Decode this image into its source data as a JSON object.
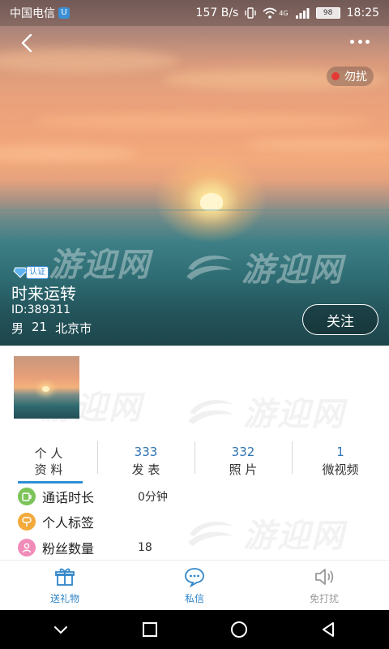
{
  "status_bar": {
    "carrier": "中国电信",
    "carrier_badge": "U",
    "network_speed": "157 B/s",
    "network_type": "4G",
    "battery": "98",
    "time": "18:25"
  },
  "header": {
    "dnd_label": "勿扰",
    "watermark": "游迎网"
  },
  "profile": {
    "verify_badge": "认证",
    "nickname": "时来运转",
    "user_id": "ID:389311",
    "gender": "男",
    "age": "21",
    "city": "北京市",
    "follow_label": "关注"
  },
  "tabs": [
    {
      "count": "",
      "label_line1": "个 人",
      "label_line2": "资 料",
      "active": true
    },
    {
      "count": "333",
      "label": "发 表"
    },
    {
      "count": "332",
      "label": "照 片"
    },
    {
      "count": "1",
      "label": "微视频"
    }
  ],
  "info_rows": [
    {
      "label": "通话时长",
      "value": "0分钟",
      "icon": "call-duration-icon",
      "color": "#7cc35a"
    },
    {
      "label": "个人标签",
      "value": "",
      "icon": "tag-icon",
      "color": "#f3a93b"
    },
    {
      "label": "粉丝数量",
      "value": "18",
      "icon": "fans-icon",
      "color": "#f08cb8"
    }
  ],
  "actions": [
    {
      "label": "送礼物",
      "icon": "gift-icon"
    },
    {
      "label": "私信",
      "icon": "message-icon"
    },
    {
      "label": "免打扰",
      "icon": "mute-icon"
    }
  ],
  "colors": {
    "accent": "#2f85c8",
    "dnd_dot": "#e53935"
  }
}
